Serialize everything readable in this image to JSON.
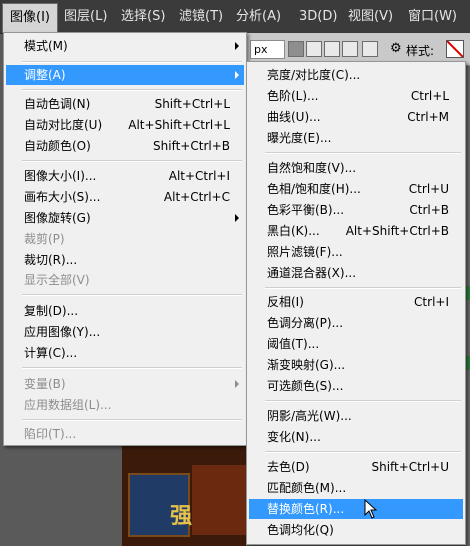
{
  "menubar": {
    "items": [
      "图像(I)",
      "图层(L)",
      "选择(S)",
      "滤镜(T)",
      "分析(A)",
      "3D(D)",
      "视图(V)",
      "窗口(W)"
    ],
    "active_index": 0
  },
  "options_bar": {
    "unit_field": "px",
    "style_label": "样式:"
  },
  "image_menu": {
    "items": [
      {
        "label": "模式(M)",
        "shortcut": "",
        "submenu": true,
        "disabled": false
      },
      {
        "label": "调整(A)",
        "shortcut": "",
        "submenu": true,
        "disabled": false,
        "highlighted": true
      },
      {
        "label": "自动色调(N)",
        "shortcut": "Shift+Ctrl+L"
      },
      {
        "label": "自动对比度(U)",
        "shortcut": "Alt+Shift+Ctrl+L"
      },
      {
        "label": "自动颜色(O)",
        "shortcut": "Shift+Ctrl+B"
      },
      {
        "label": "图像大小(I)...",
        "shortcut": "Alt+Ctrl+I"
      },
      {
        "label": "画布大小(S)...",
        "shortcut": "Alt+Ctrl+C"
      },
      {
        "label": "图像旋转(G)",
        "shortcut": "",
        "submenu": true
      },
      {
        "label": "裁剪(P)",
        "shortcut": "",
        "disabled": true
      },
      {
        "label": "裁切(R)...",
        "shortcut": ""
      },
      {
        "label": "显示全部(V)",
        "shortcut": "",
        "disabled": true
      },
      {
        "label": "复制(D)...",
        "shortcut": ""
      },
      {
        "label": "应用图像(Y)...",
        "shortcut": ""
      },
      {
        "label": "计算(C)...",
        "shortcut": ""
      },
      {
        "label": "变量(B)",
        "shortcut": "",
        "submenu": true,
        "disabled": true
      },
      {
        "label": "应用数据组(L)...",
        "shortcut": "",
        "disabled": true
      },
      {
        "label": "陷印(T)...",
        "shortcut": "",
        "disabled": true
      }
    ]
  },
  "adjust_menu": {
    "items": [
      {
        "label": "亮度/对比度(C)...",
        "shortcut": ""
      },
      {
        "label": "色阶(L)...",
        "shortcut": "Ctrl+L"
      },
      {
        "label": "曲线(U)...",
        "shortcut": "Ctrl+M"
      },
      {
        "label": "曝光度(E)...",
        "shortcut": ""
      },
      {
        "label": "自然饱和度(V)...",
        "shortcut": ""
      },
      {
        "label": "色相/饱和度(H)...",
        "shortcut": "Ctrl+U"
      },
      {
        "label": "色彩平衡(B)...",
        "shortcut": "Ctrl+B"
      },
      {
        "label": "黑白(K)...",
        "shortcut": "Alt+Shift+Ctrl+B"
      },
      {
        "label": "照片滤镜(F)...",
        "shortcut": ""
      },
      {
        "label": "通道混合器(X)...",
        "shortcut": ""
      },
      {
        "label": "反相(I)",
        "shortcut": "Ctrl+I"
      },
      {
        "label": "色调分离(P)...",
        "shortcut": ""
      },
      {
        "label": "阈值(T)...",
        "shortcut": ""
      },
      {
        "label": "渐变映射(G)...",
        "shortcut": ""
      },
      {
        "label": "可选颜色(S)...",
        "shortcut": ""
      },
      {
        "label": "阴影/高光(W)...",
        "shortcut": ""
      },
      {
        "label": "变化(N)...",
        "shortcut": ""
      },
      {
        "label": "去色(D)",
        "shortcut": "Shift+Ctrl+U"
      },
      {
        "label": "匹配颜色(M)...",
        "shortcut": ""
      },
      {
        "label": "替换颜色(R)...",
        "shortcut": "",
        "highlighted": true
      },
      {
        "label": "色调均化(Q)",
        "shortcut": ""
      }
    ]
  },
  "colors": {
    "menubar_bg": "#3b3b3b",
    "menu_bg": "#f0f0f0",
    "highlight": "#3399ff",
    "disabled_text": "#8d8d8d"
  },
  "canvas": {
    "partial_text": "强"
  }
}
